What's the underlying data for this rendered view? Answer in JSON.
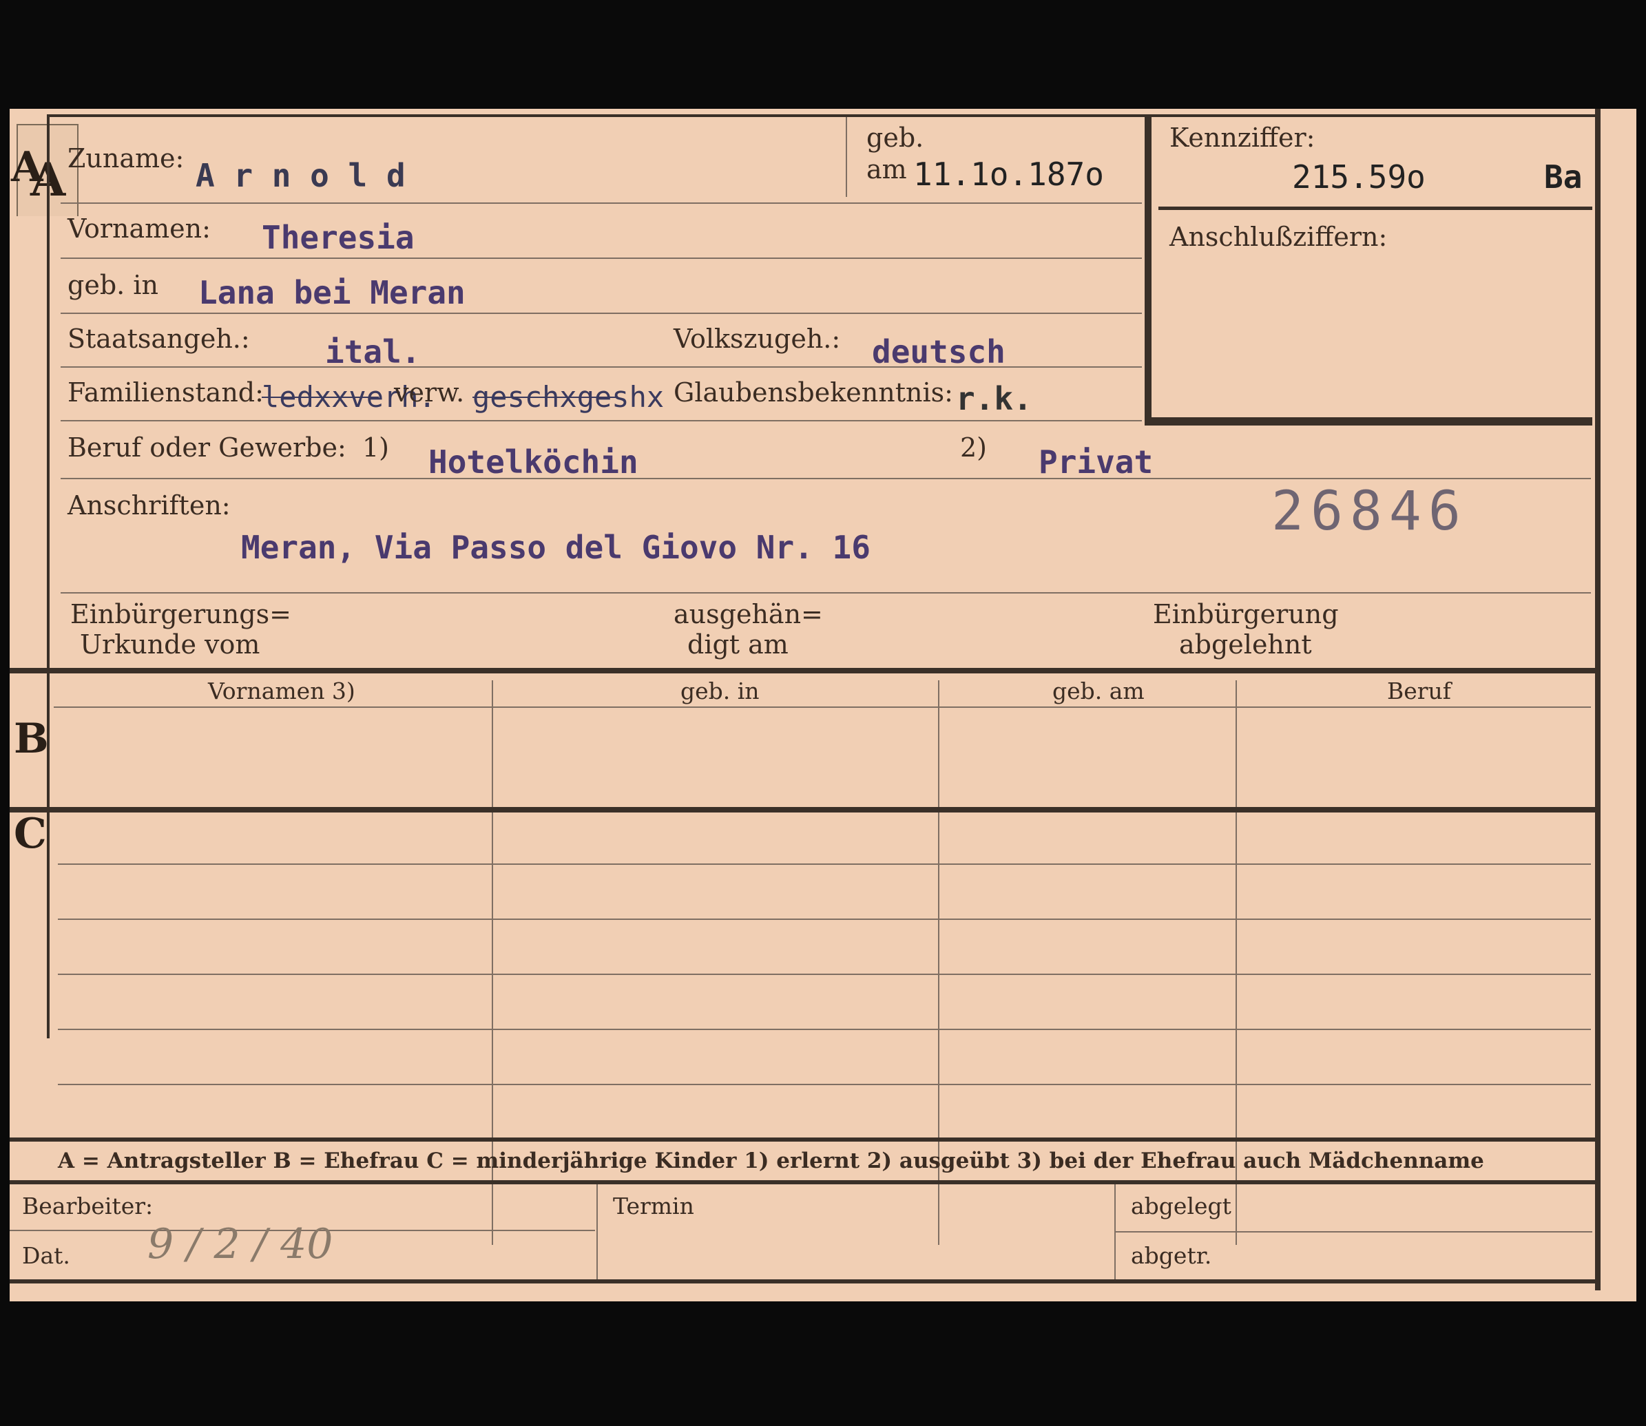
{
  "tab_letter": "A",
  "section_letters": {
    "a": "A",
    "b": "B",
    "c": "C"
  },
  "fields": {
    "zuname_label": "Zuname:",
    "zuname_value": "A r n o l d",
    "geb_label": "geb.",
    "am_label": "am",
    "geb_am_value": "11.1o.187o",
    "vornamen_label": "Vornamen:",
    "vornamen_value": "Theresia",
    "geb_in_label": "geb. in",
    "geb_in_value": "Lana bei Meran",
    "staatsangeh_label": "Staatsangeh.:",
    "staatsangeh_value": "ital.",
    "volkszugeh_label": "Volkszugeh.:",
    "volkszugeh_value": "deutsch",
    "familienstand_label": "Familienstand:",
    "familienstand_struck1": "ledxxverh.",
    "verw_label": "verw.",
    "familienstand_struck2": "geschxgeshx",
    "glaubens_label": "Glaubensbekenntnis:",
    "glaubens_value": "r.k.",
    "beruf_label": "Beruf oder Gewerbe:",
    "beruf_note1": "1)",
    "beruf_value1": "Hotelköchin",
    "beruf_note2": "2)",
    "beruf_value2": "Privat",
    "anschriften_label": "Anschriften:",
    "anschrift_value": "Meran, Via Passo del Giovo Nr. 16",
    "stamp_number": "26846",
    "einbuergerung_label_1": "Einbürgerungs=",
    "einbuergerung_label_2": "Urkunde vom",
    "ausgehaen_label_1": "ausgehän=",
    "ausgehaen_label_2": "digt am",
    "abgelehnt_label_1": "Einbürgerung",
    "abgelehnt_label_2": "abgelehnt"
  },
  "kennziffer": {
    "label": "Kennziffer:",
    "value": "215.59o",
    "suffix": "Ba",
    "anschluss_label": "Anschlußziffern:"
  },
  "table_b": {
    "headers": [
      "Vornamen 3)",
      "geb. in",
      "geb. am",
      "Beruf"
    ]
  },
  "legend": "A = Antragsteller   B = Ehefrau   C = minderjährige Kinder   1) erlernt   2) ausgeübt   3) bei der Ehefrau auch Mädchenname",
  "footer": {
    "bearbeiter_label": "Bearbeiter:",
    "dat_label": "Dat.",
    "dat_value": "9 / 2 / 40",
    "termin_label": "Termin",
    "abgelegt_label": "abgelegt",
    "abgetr_label": "abgetr."
  }
}
